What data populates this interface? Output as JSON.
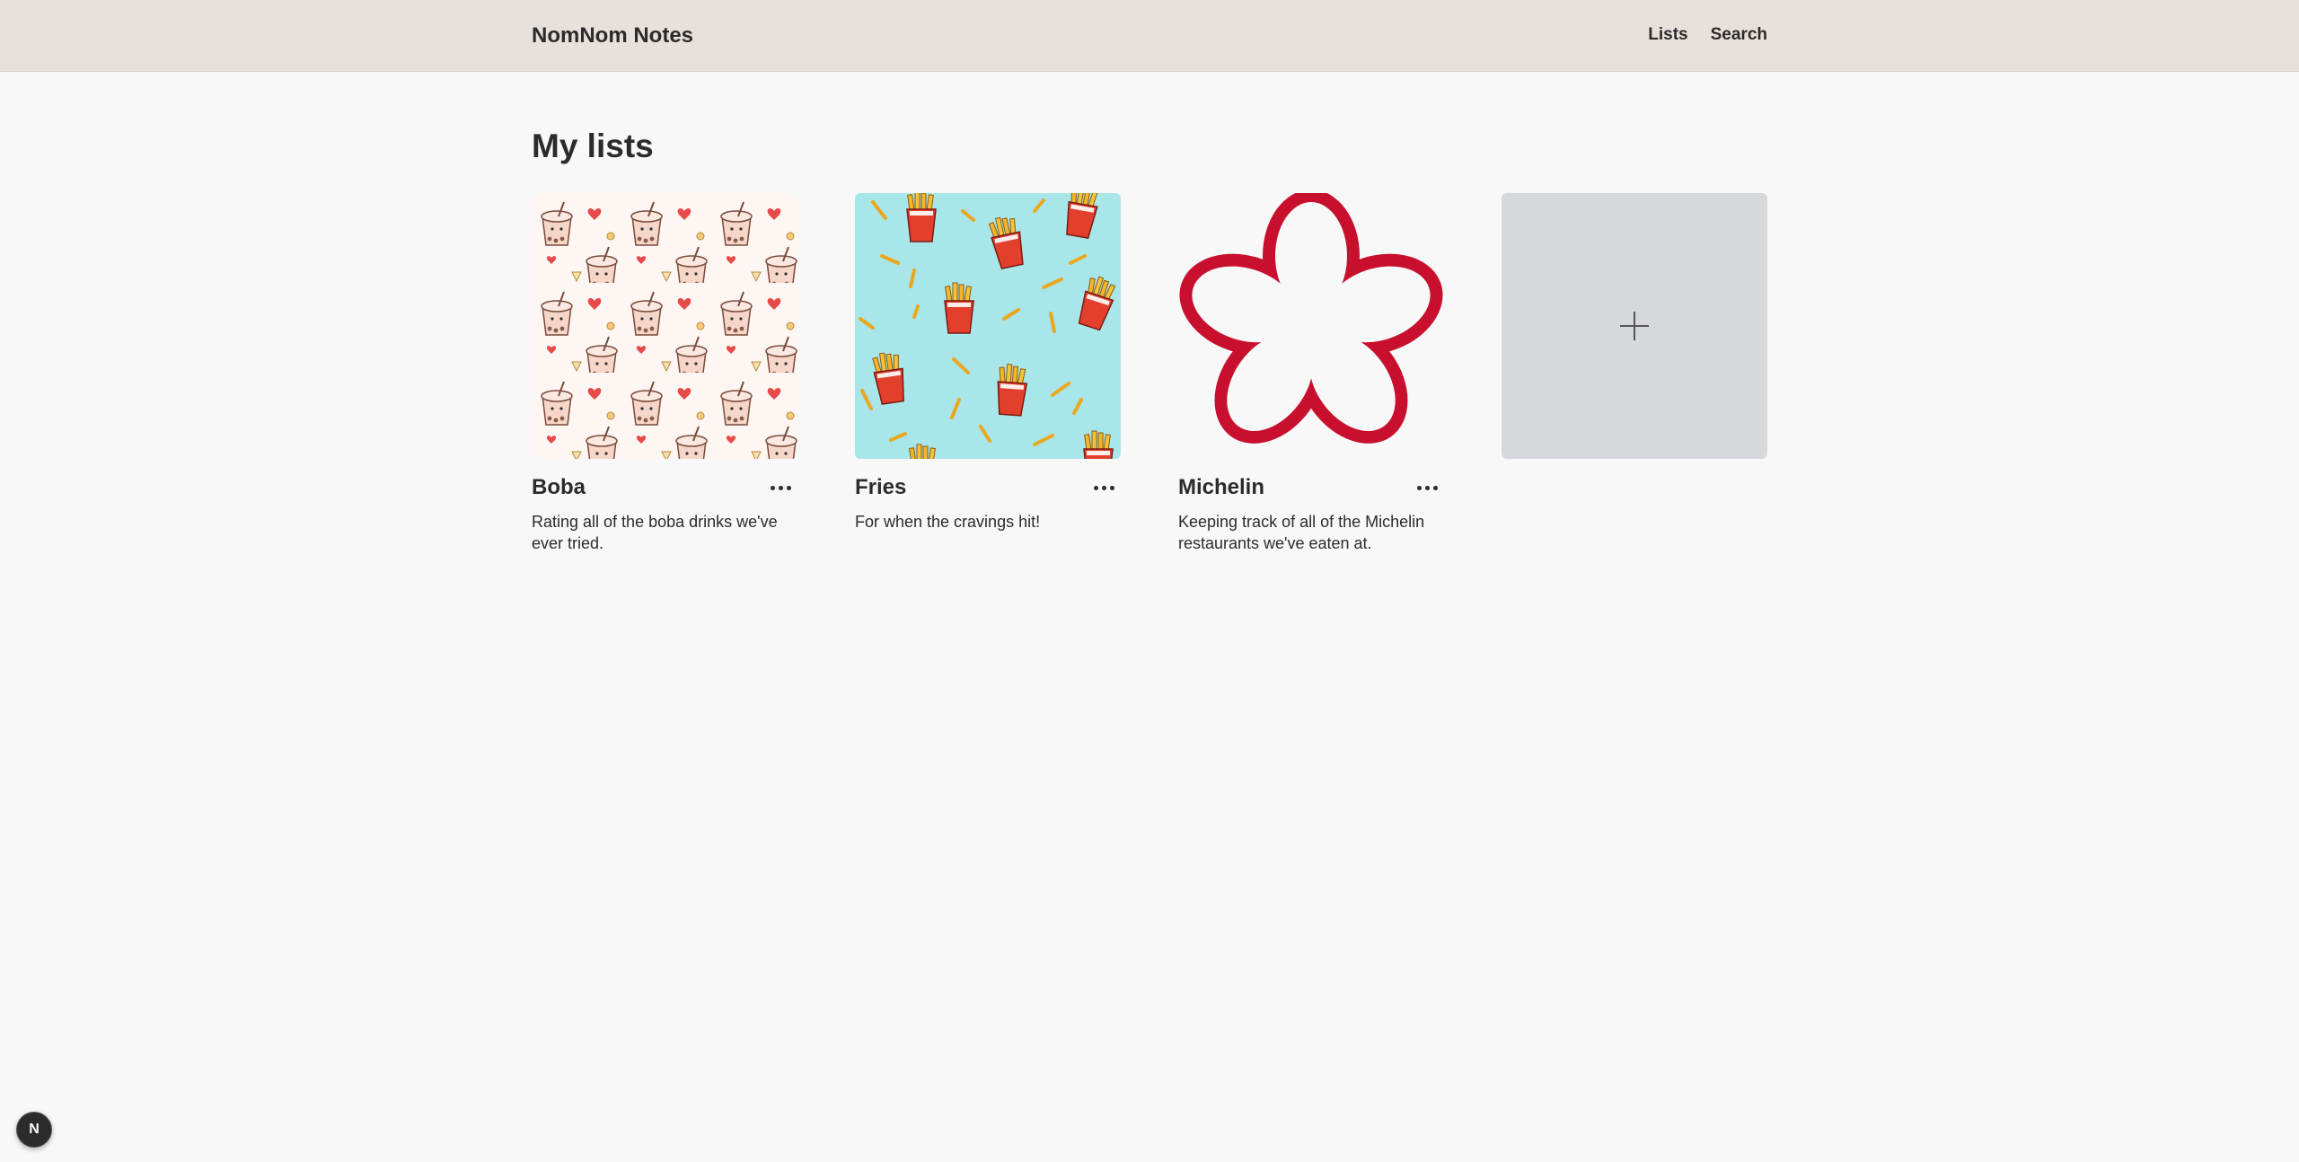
{
  "header": {
    "brand": "NomNom Notes",
    "nav": {
      "lists_label": "Lists",
      "search_label": "Search"
    }
  },
  "main": {
    "title": "My lists",
    "lists": [
      {
        "name": "Boba",
        "description": "Rating all of the boba drinks we've ever tried.",
        "cover": "boba-pattern"
      },
      {
        "name": "Fries",
        "description": "For when the cravings hit!",
        "cover": "fries-pattern"
      },
      {
        "name": "Michelin",
        "description": "Keeping track of all of the Michelin restaurants we've eaten at.",
        "cover": "michelin-star-logo"
      }
    ],
    "add_card_icon": "plus-icon"
  },
  "dev_badge": {
    "label": "N"
  },
  "colors": {
    "header_bg": "#e8e0db",
    "page_bg": "#f8f8f8",
    "add_card_bg": "#d6d8dc",
    "fries_bg": "#a8e6ea",
    "michelin_red": "#c8102e",
    "boba_bg": "#fdf6f2"
  }
}
